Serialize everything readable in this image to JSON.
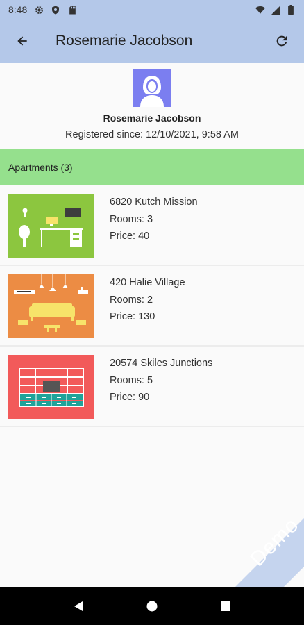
{
  "status_bar": {
    "time": "8:48",
    "left_icons": [
      "gear-icon",
      "shield-icon",
      "sd-card-icon"
    ],
    "right_icons": [
      "wifi-icon",
      "signal-icon",
      "battery-icon"
    ]
  },
  "app_bar": {
    "title": "Rosemarie Jacobson",
    "back_icon": "arrow-left-icon",
    "refresh_icon": "refresh-icon"
  },
  "profile": {
    "name": "Rosemarie Jacobson",
    "registered": "Registered since: 12/10/2021, 9:58 AM"
  },
  "apartments_header": "Apartments (3)",
  "apartments": [
    {
      "address": "6820 Kutch Mission",
      "rooms": "Rooms: 3",
      "price": "Price: 40",
      "thumb_color": "#8cc63f"
    },
    {
      "address": "420 Halie Village",
      "rooms": "Rooms: 2",
      "price": "Price: 130",
      "thumb_color": "#ec8c44"
    },
    {
      "address": "20574 Skiles Junctions",
      "rooms": "Rooms: 5",
      "price": "Price: 90",
      "thumb_color": "#f25a5a"
    }
  ],
  "demo_label": "Demo",
  "colors": {
    "app_bar": "#b4c8e9",
    "section_header": "#95e08d",
    "avatar": "#7b7ef0",
    "ribbon": "#c5d4ee"
  }
}
